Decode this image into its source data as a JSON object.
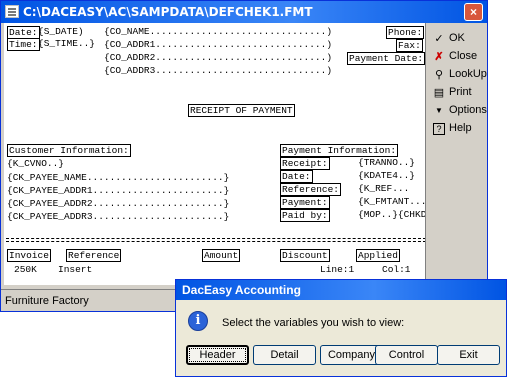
{
  "window": {
    "title": "C:\\DACEASY\\AC\\SAMPDATA\\DEFCHEK1.FMT",
    "close": "×",
    "footer": "Furniture Factory"
  },
  "editor": {
    "date_label": "Date:",
    "date_field": "{S_DATE)",
    "time_label": "Time:",
    "time_field": "{S_TIME..}",
    "co_name": "{CO_NAME...............................)",
    "co_addr1": "{CO_ADDR1..............................)",
    "co_addr2": "{CO_ADDR2..............................)",
    "co_addr3": "{CO_ADDR3..............................)",
    "phone": "Phone:",
    "fax": "Fax:",
    "payment_date": "Payment Date:",
    "receipt_title": "RECEIPT OF PAYMENT",
    "customer_info": "Customer Information:",
    "cvno": "{K_CVNO..}",
    "payee_name": "{CK_PAYEE_NAME........................}",
    "payee_addr1": "{CK_PAYEE_ADDR1.......................}",
    "payee_addr2": "{CK_PAYEE_ADDR2.......................}",
    "payee_addr3": "{CK_PAYEE_ADDR3.......................}",
    "payment_info": "Payment Information:",
    "receipt_lbl": "Receipt:",
    "receipt_val": "{TRANNO..}",
    "date_lbl": "Date:",
    "date_val": "{KDATE4..}",
    "reference_lbl": "Reference:",
    "reference_val": "{K_REF...",
    "payment_lbl": "Payment:",
    "payment_val": "{K_FMTANT...",
    "paidby_lbl": "Paid by:",
    "paidby_val": "{MOP..}{CHKD",
    "columns": [
      "Invoice",
      "Reference",
      "Amount",
      "Discount",
      "Applied"
    ]
  },
  "status": {
    "size": "250K",
    "mode": "Insert",
    "line": "Line:1",
    "col": "Col:1"
  },
  "toolbar": {
    "items": [
      {
        "label": "OK",
        "icon": "check-icon"
      },
      {
        "label": "Close",
        "icon": "close-doc-icon"
      },
      {
        "label": "LookUp",
        "icon": "magnifier-icon"
      },
      {
        "label": "Print",
        "icon": "printer-icon"
      },
      {
        "label": "Options",
        "icon": "triangle-down-icon"
      },
      {
        "label": "Help",
        "icon": "help-icon"
      }
    ]
  },
  "dialog": {
    "title": "DacEasy Accounting",
    "message": "Select the variables you wish to view:",
    "icon": "info-icon",
    "buttons": [
      "Header",
      "Detail",
      "Company",
      "Control",
      "Exit"
    ]
  }
}
